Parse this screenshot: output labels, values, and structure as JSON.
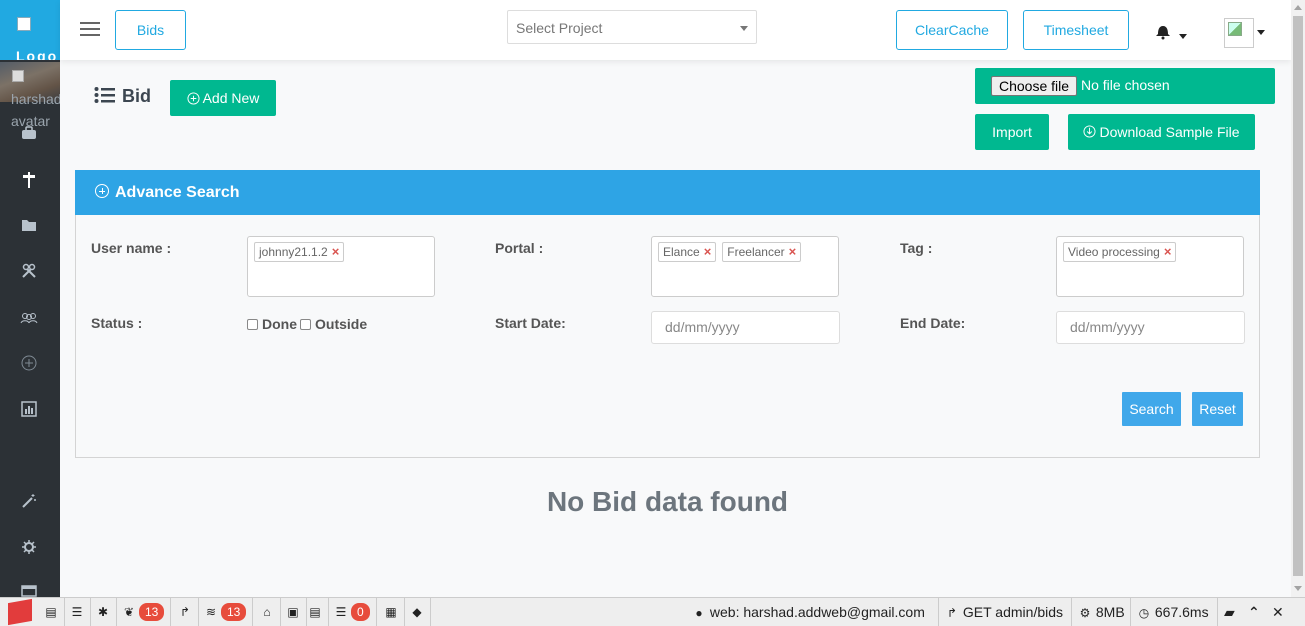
{
  "sidebar": {
    "logo_text": "Logo",
    "avatar_alt": "harshad avatar"
  },
  "topbar": {
    "bids_label": "Bids",
    "project_placeholder": "Select Project",
    "clearcache_label": "ClearCache",
    "timesheet_label": "Timesheet"
  },
  "page": {
    "title": "Bid",
    "add_new_label": "Add New",
    "choose_file_label": "Choose file",
    "no_file_text": "No file chosen",
    "import_label": "Import",
    "download_label": "Download Sample File",
    "no_data_text": "No Bid data found"
  },
  "search": {
    "title": "Advance Search",
    "username_label": "User name :",
    "username_tags": [
      "johnny21.1.2"
    ],
    "portal_label": "Portal :",
    "portal_tags": [
      "Elance",
      "Freelancer"
    ],
    "tag_label": "Tag :",
    "tag_tags": [
      "Video processing"
    ],
    "status_label": "Status :",
    "status_done": "Done",
    "status_outside": "Outside",
    "start_date_label": "Start Date:",
    "start_date_placeholder": "dd/mm/yyyy",
    "end_date_label": "End Date:",
    "end_date_placeholder": "dd/mm/yyyy",
    "search_label": "Search",
    "reset_label": "Reset"
  },
  "debugbar": {
    "badge_views": "13",
    "badge_queries": "13",
    "badge_mails": "0",
    "user_text": "web: harshad.addweb@gmail.com",
    "route_text": "GET admin/bids",
    "memory_text": "8MB",
    "time_text": "667.6ms"
  },
  "colors": {
    "sidebar": "#2c3136",
    "primary_blue": "#21a9e1",
    "panel_blue": "#2ea4e5",
    "green": "#00b890",
    "danger": "#e74c3c"
  }
}
